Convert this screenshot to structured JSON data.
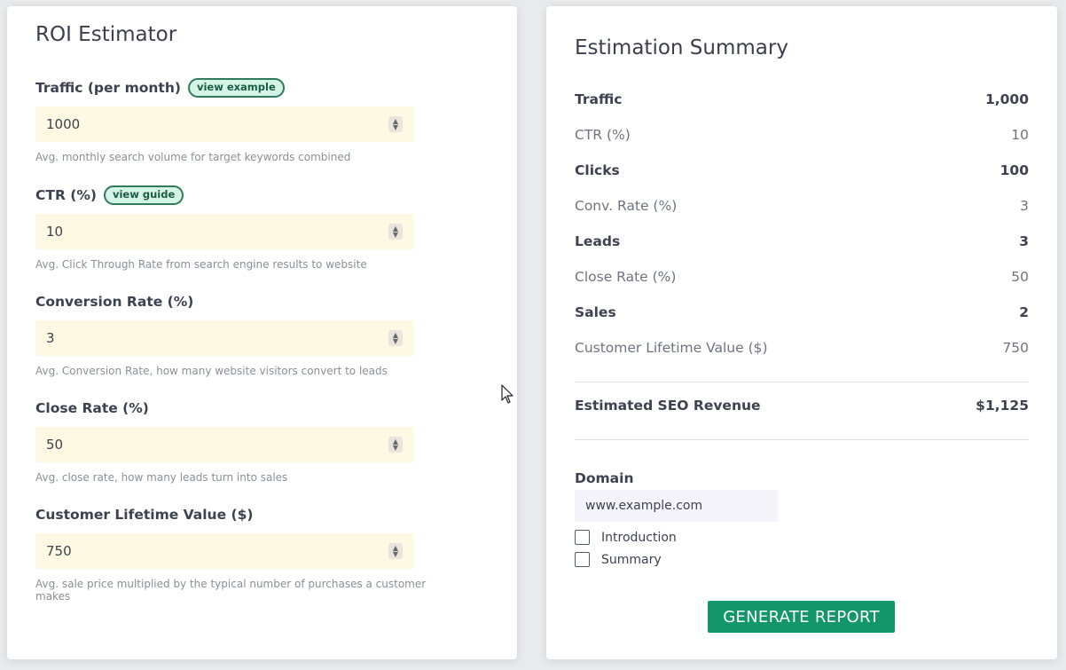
{
  "left_panel": {
    "title": "ROI Estimator",
    "fields": [
      {
        "label": "Traffic (per month)",
        "link": "view example",
        "value": "1000",
        "help": "Avg. monthly search volume for target keywords combined"
      },
      {
        "label": "CTR (%)",
        "link": "view guide",
        "value": "10",
        "help": "Avg. Click Through Rate from search engine results to website"
      },
      {
        "label": "Conversion Rate (%)",
        "value": "3",
        "help": "Avg. Conversion Rate, how many website visitors convert to leads"
      },
      {
        "label": "Close Rate (%)",
        "value": "50",
        "help": "Avg. close rate, how many leads turn into sales"
      },
      {
        "label": "Customer Lifetime Value ($)",
        "value": "750",
        "help": "Avg. sale price multiplied by the typical number of purchases a customer makes"
      }
    ]
  },
  "right_panel": {
    "title": "Estimation Summary",
    "rows": [
      {
        "label": "Traffic",
        "value": "1,000"
      },
      {
        "label": "CTR (%)",
        "value": "10"
      },
      {
        "label": "Clicks",
        "value": "100"
      },
      {
        "label": "Conv. Rate (%)",
        "value": "3"
      },
      {
        "label": "Leads",
        "value": "3"
      },
      {
        "label": "Close Rate (%)",
        "value": "50"
      },
      {
        "label": "Sales",
        "value": "2"
      },
      {
        "label": "Customer Lifetime Value ($)",
        "value": "750"
      }
    ],
    "total": {
      "label": "Estimated SEO Revenue",
      "value": "$1,125"
    },
    "domain": {
      "label": "Domain",
      "value": "www.example.com"
    },
    "checkboxes": [
      {
        "label": "Introduction",
        "checked": false
      },
      {
        "label": "Summary",
        "checked": false
      }
    ],
    "button": "GENERATE REPORT"
  },
  "colors": {
    "input_bg": "#fdf9e3",
    "pill_bg": "#d4f5e6",
    "button_bg": "#12966a"
  }
}
